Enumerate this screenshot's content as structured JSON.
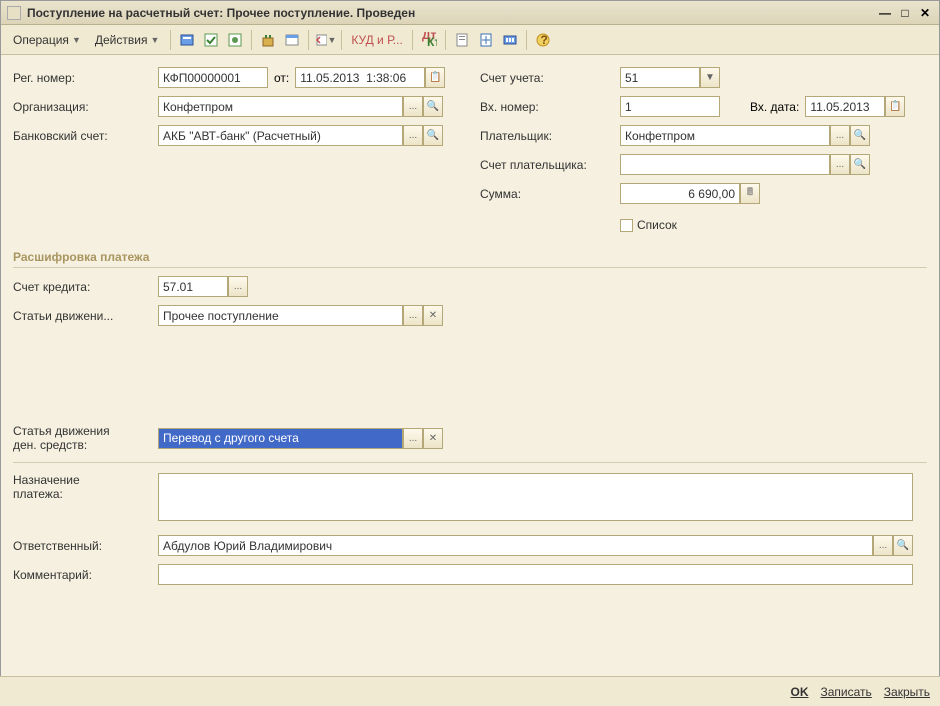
{
  "window": {
    "title": "Поступление на расчетный счет: Прочее поступление. Проведен"
  },
  "menu": {
    "operation": "Операция",
    "actions": "Действия",
    "kudr": "КУД и Р..."
  },
  "labels": {
    "regNumber": "Рег. номер:",
    "from": "от:",
    "organization": "Организация:",
    "bankAccount": "Банковский счет:",
    "account": "Счет учета:",
    "incNumber": "Вх. номер:",
    "incDate": "Вх. дата:",
    "payer": "Плательщик:",
    "payerAccount": "Счет плательщика:",
    "amount": "Сумма:",
    "list": "Список",
    "breakdown": "Расшифровка платежа",
    "creditAccount": "Счет кредита:",
    "movementArticle": "Статьи движени...",
    "cashFlowArticle1": "Статья движения",
    "cashFlowArticle2": "ден. средств:",
    "purpose": "Назначение",
    "purpose2": "платежа:",
    "responsible": "Ответственный:",
    "comment": "Комментарий:"
  },
  "values": {
    "regNumber": "КФП00000001",
    "date": "11.05.2013  1:38:06",
    "organization": "Конфетпром",
    "bankAccount": "АКБ \"АВТ-банк\" (Расчетный)",
    "account": "51",
    "incNumber": "1",
    "incDate": "11.05.2013",
    "payer": "Конфетпром",
    "payerAccount": "",
    "amount": "6 690,00",
    "creditAccount": "57.01",
    "movementArticle": "Прочее поступление",
    "cashFlowArticle": "Перевод с другого счета",
    "purpose": "",
    "responsible": "Абдулов Юрий Владимирович",
    "comment": ""
  },
  "footer": {
    "ok": "OK",
    "save": "Записать",
    "close": "Закрыть"
  }
}
